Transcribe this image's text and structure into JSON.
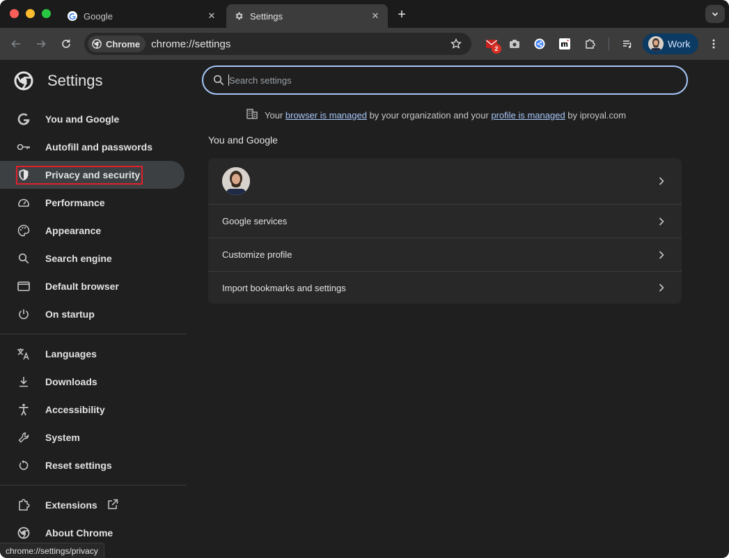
{
  "tabs": [
    {
      "title": "Google",
      "icon": "google-icon"
    },
    {
      "title": "Settings",
      "icon": "gear-icon"
    }
  ],
  "omnibox": {
    "chip_label": "Chrome",
    "url": "chrome://settings"
  },
  "extensions": {
    "mail_badge": "2"
  },
  "profile": {
    "label": "Work"
  },
  "sidebar": {
    "title": "Settings",
    "items": [
      {
        "label": "You and Google",
        "icon": "google-g-icon"
      },
      {
        "label": "Autofill and passwords",
        "icon": "key-icon"
      },
      {
        "label": "Privacy and security",
        "icon": "shield-icon"
      },
      {
        "label": "Performance",
        "icon": "speedometer-icon"
      },
      {
        "label": "Appearance",
        "icon": "palette-icon"
      },
      {
        "label": "Search engine",
        "icon": "search-icon"
      },
      {
        "label": "Default browser",
        "icon": "browser-window-icon"
      },
      {
        "label": "On startup",
        "icon": "power-icon"
      },
      {
        "label": "Languages",
        "icon": "translate-icon"
      },
      {
        "label": "Downloads",
        "icon": "download-icon"
      },
      {
        "label": "Accessibility",
        "icon": "accessibility-icon"
      },
      {
        "label": "System",
        "icon": "wrench-icon"
      },
      {
        "label": "Reset settings",
        "icon": "reset-icon"
      },
      {
        "label": "Extensions",
        "icon": "puzzle-icon"
      },
      {
        "label": "About Chrome",
        "icon": "chrome-icon"
      }
    ]
  },
  "search": {
    "placeholder": "Search settings"
  },
  "managed": {
    "prefix": "Your ",
    "link1": "browser is managed",
    "middle": " by your organization and your ",
    "link2": "profile is managed",
    "suffix": " by iproyal.com"
  },
  "section": {
    "title": "You and Google",
    "rows": [
      "Google services",
      "Customize profile",
      "Import bookmarks and settings"
    ]
  },
  "status_url": "chrome://settings/privacy",
  "colors": {
    "accent": "#a8c7fa",
    "highlight_box": "#e0202a",
    "profile_pill": "#0b3a63"
  }
}
